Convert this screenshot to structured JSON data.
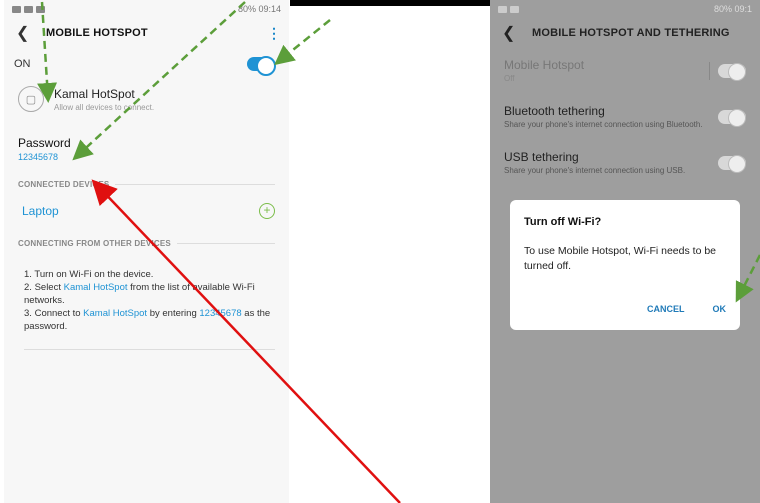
{
  "left_phone": {
    "status_time": "80% 09:14",
    "title": "MOBILE HOTSPOT",
    "on_label": "ON",
    "hotspot_name": "Kamal HotSpot",
    "hotspot_sub": "Allow all devices to connect.",
    "password_label": "Password",
    "password_value": "12345678",
    "connected_header": "CONNECTED DEVICES",
    "device_name": "Laptop",
    "connecting_header": "CONNECTING FROM OTHER DEVICES",
    "steps": [
      {
        "num": "1.",
        "parts": [
          "Turn on Wi-Fi on the device."
        ]
      },
      {
        "num": "2.",
        "pre": "Select ",
        "link": "Kamal HotSpot",
        "post": " from the list of available Wi-Fi networks."
      },
      {
        "num": "3.",
        "pre": "Connect to ",
        "link": "Kamal HotSpot",
        "mid": " by entering ",
        "link2": "12345678",
        "post": " as the password."
      }
    ]
  },
  "right_phone": {
    "status_time": "80% 09:1",
    "title": "MOBILE HOTSPOT AND TETHERING",
    "items": [
      {
        "title": "Mobile Hotspot",
        "sub": "Off"
      },
      {
        "title": "Bluetooth tethering",
        "sub": "Share your phone's internet connection using Bluetooth."
      },
      {
        "title": "USB tethering",
        "sub": "Share your phone's internet connection using USB."
      }
    ],
    "dialog": {
      "title": "Turn off Wi-Fi?",
      "body": "To use Mobile Hotspot, Wi-Fi needs to be turned off.",
      "cancel": "CANCEL",
      "ok": "OK"
    }
  },
  "colors": {
    "accent": "#1f93d4",
    "arrow_green": "#5c9e3a",
    "arrow_red": "#e01010"
  }
}
